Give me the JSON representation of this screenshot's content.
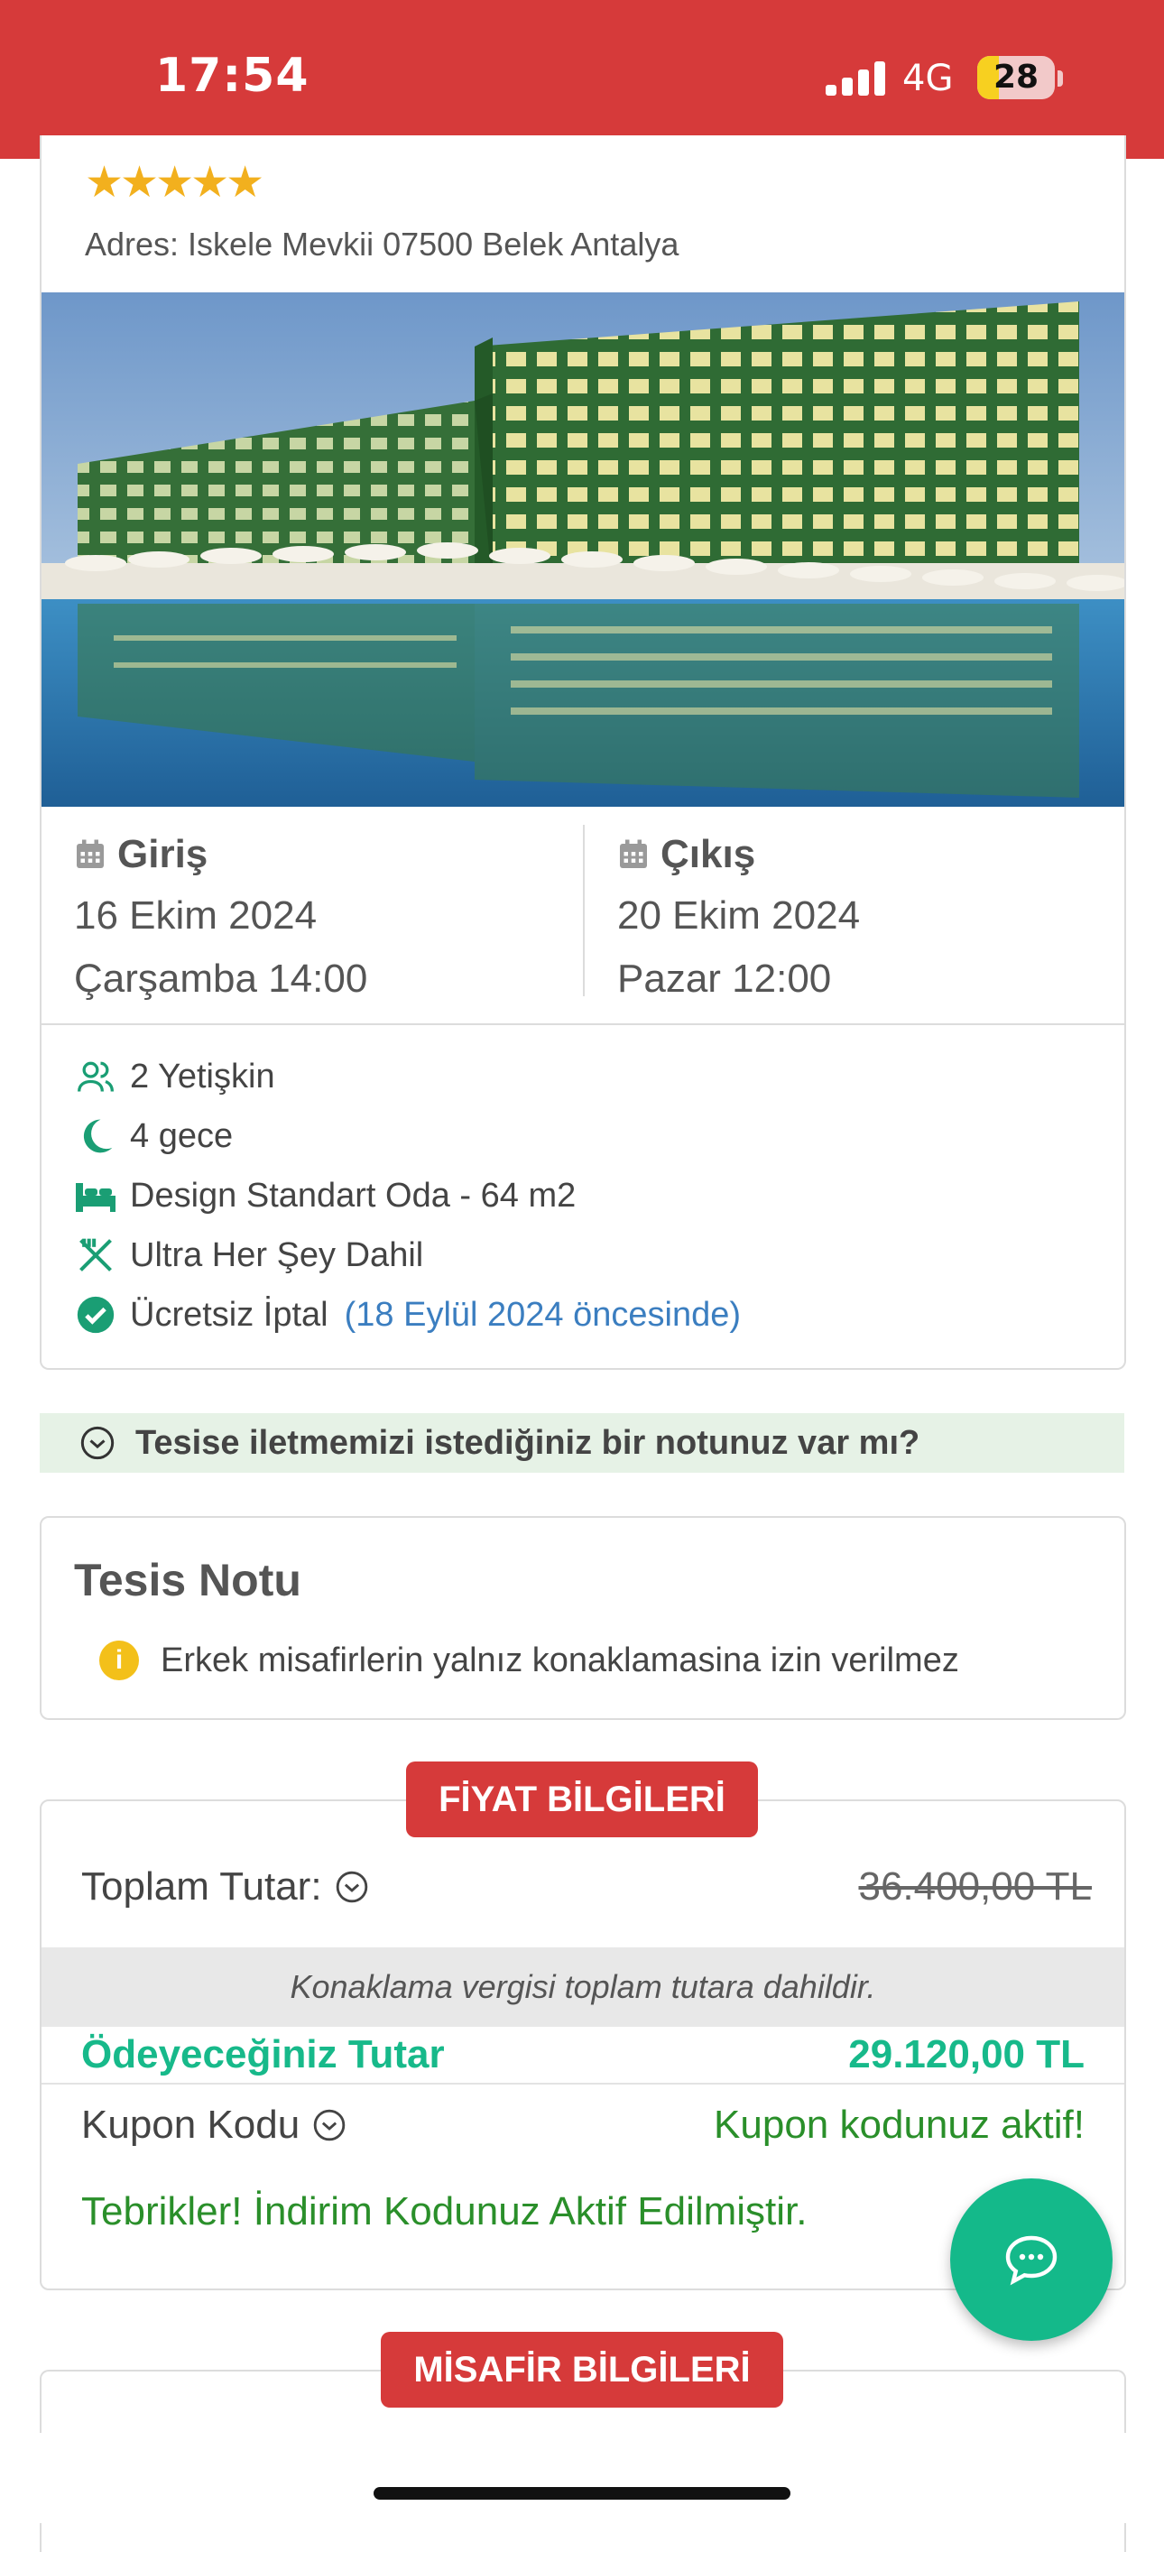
{
  "status_bar": {
    "time": "17:54",
    "network": "4G",
    "battery": "28",
    "battery_level": 0.28
  },
  "hotel": {
    "stars": "★★★★★",
    "address": "Adres: Iskele Mevkii 07500 Belek Antalya",
    "photo_icon": "hotel-building-photo"
  },
  "checkin": {
    "label": "Giriş",
    "date": "16 Ekim 2024",
    "time": "Çarşamba 14:00"
  },
  "checkout": {
    "label": "Çıkış",
    "date": "20 Ekim 2024",
    "time": "Pazar 12:00"
  },
  "features": {
    "guests": "2 Yetişkin",
    "nights": "4 gece",
    "room": "Design Standart Oda - 64 m2",
    "board": "Ultra Her Şey Dahil",
    "cancellation": "Ücretsiz İptal",
    "cancellation_deadline": "(18 Eylül 2024 öncesinde)"
  },
  "note_prompt": "Tesise iletmemizi istediğiniz bir notunuz var mı?",
  "facility_note": {
    "title": "Tesis Notu",
    "message": "Erkek misafirlerin yalnız konaklamasina izin verilmez"
  },
  "price": {
    "section_title": "FİYAT BİLGİLERİ",
    "total_label": "Toplam Tutar:",
    "total_old": "36.400,00 TL",
    "tax_note": "Konaklama vergisi toplam tutara dahildir.",
    "pay_label": "Ödeyeceğiniz Tutar",
    "pay_value": "29.120,00 TL",
    "coupon_label": "Kupon Kodu",
    "coupon_status": "Kupon kodunuz aktif!",
    "congrats": "Tebrikler! İndirim Kodunuz Aktif Edilmiştir."
  },
  "guest_section": {
    "title": "MİSAFİR BİLGİLERİ"
  },
  "colors": {
    "brand_red": "#d63a3a",
    "accent_green": "#14b98a",
    "success_green": "#2a8f2a",
    "link_blue": "#3b7ec0"
  }
}
